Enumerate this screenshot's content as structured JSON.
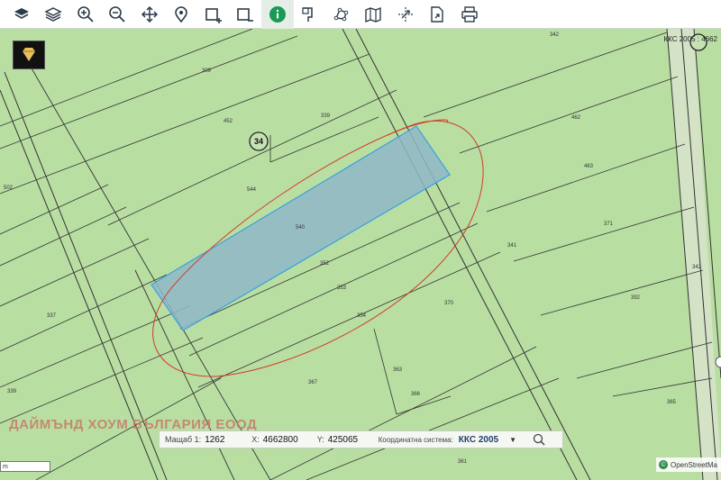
{
  "toolbar": {
    "tools": [
      {
        "name": "layers-icon"
      },
      {
        "name": "layers-stack-icon"
      },
      {
        "name": "zoom-in-icon"
      },
      {
        "name": "zoom-out-icon"
      },
      {
        "name": "pan-arrows-icon"
      },
      {
        "name": "location-pin-icon"
      },
      {
        "name": "select-area-icon"
      },
      {
        "name": "deselect-area-icon"
      },
      {
        "name": "info-icon",
        "active": true
      },
      {
        "name": "measure-distance-icon"
      },
      {
        "name": "measure-polygon-icon"
      },
      {
        "name": "map-icon"
      },
      {
        "name": "coordinates-icon"
      },
      {
        "name": "export-icon"
      },
      {
        "name": "print-icon"
      }
    ],
    "accent_color": "#1a9a55"
  },
  "map": {
    "crs_top": "ККС 2005 : 4662",
    "parcel_labels": [
      "342",
      "309",
      "452",
      "339",
      "462",
      "463",
      "371",
      "502",
      "544",
      "341",
      "352",
      "353",
      "354",
      "370",
      "337",
      "367",
      "363",
      "342",
      "365",
      "392",
      "366",
      "339",
      "361",
      "540"
    ],
    "marker_label": "34",
    "highlight_color": "#7fb8c4",
    "circle_color": "#d23a2a"
  },
  "watermark": "ДАЙМЪНД ХОУМ БЪЛГАРИЯ ЕООД",
  "coordbar": {
    "scale_label": "Мащаб 1:",
    "scale_value": "1262",
    "x_label": "X:",
    "x_value": "4662800",
    "y_label": "Y:",
    "y_value": "425065",
    "crs_label": "Координатна система:",
    "crs_value": "ККС 2005"
  },
  "scale_text": "m",
  "attribution": "OpenStreetMa"
}
